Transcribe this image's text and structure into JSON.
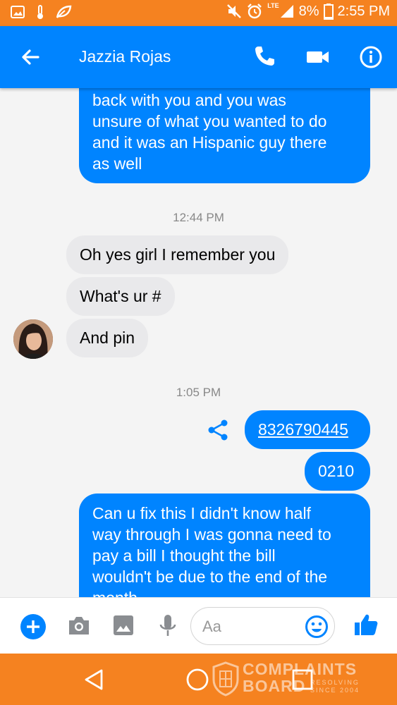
{
  "status_bar": {
    "battery": "8%",
    "time": "2:55 PM",
    "network": "LTE",
    "icons": [
      "image-icon",
      "thermometer-icon",
      "leaf-icon",
      "mute-icon",
      "alarm-icon",
      "signal-icon",
      "battery-icon"
    ]
  },
  "header": {
    "contact_name": "Jazzia Rojas",
    "icons": [
      "back-arrow-icon",
      "phone-icon",
      "video-icon",
      "info-icon"
    ],
    "color": "#0084ff"
  },
  "messages": [
    {
      "from": "me",
      "lines": [
        "back with you and you was",
        "unsure of what you wanted to do",
        "and it was an Hispanic guy there",
        "as well"
      ]
    },
    {
      "type": "timestamp",
      "text": "12:44 PM"
    },
    {
      "from": "them",
      "text": "Oh yes girl I remember you"
    },
    {
      "from": "them",
      "text": "What's ur #"
    },
    {
      "from": "them",
      "text": "And pin"
    },
    {
      "type": "timestamp",
      "text": "1:05 PM"
    },
    {
      "from": "me",
      "text": "8326790445"
    },
    {
      "from": "me",
      "text": "0210"
    },
    {
      "from": "me",
      "lines": [
        "Can u fix this I didn't know half",
        "way through I was gonna need to",
        "pay a bill I thought the bill",
        "wouldn't be due to the end of the",
        "month"
      ]
    }
  ],
  "composer": {
    "placeholder": "Aa",
    "icons": [
      "plus-icon",
      "camera-icon",
      "gallery-icon",
      "microphone-icon",
      "emoji-icon",
      "thumbs-up-icon"
    ]
  },
  "nav_bar": {
    "icons": [
      "nav-back-icon",
      "nav-home-icon",
      "nav-recent-icon"
    ]
  },
  "watermark": {
    "line1": "COMPLAINTS",
    "line2": "BOARD",
    "tag1": "RESOLVING",
    "tag2": "SINCE 2004"
  },
  "colors": {
    "accent": "#0084ff",
    "status_bar": "#f58220",
    "incoming_bubble": "#e9e9eb"
  }
}
